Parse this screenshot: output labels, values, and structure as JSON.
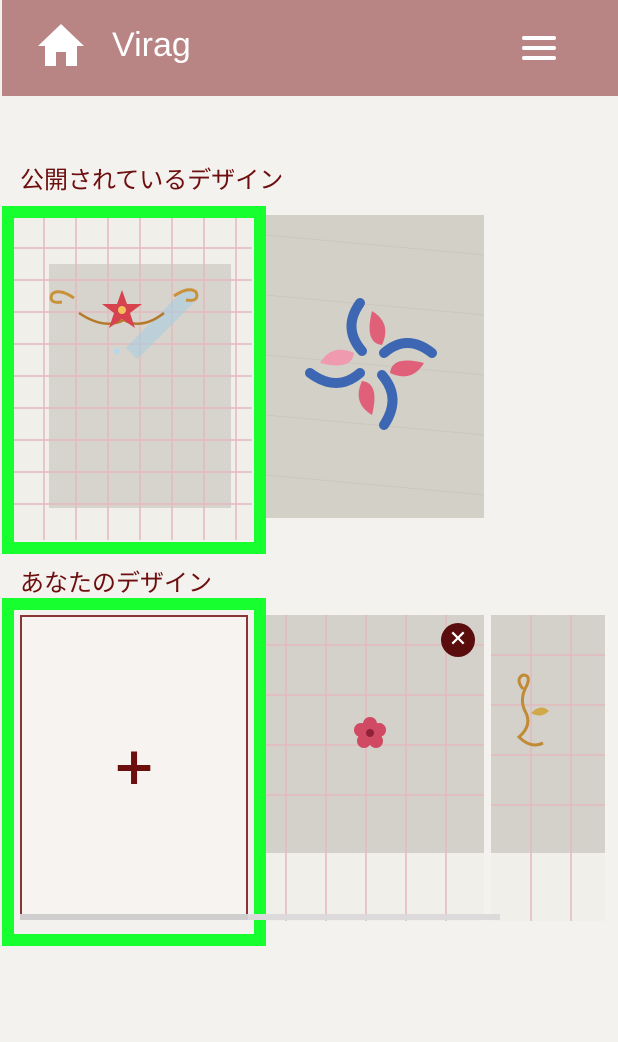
{
  "header": {
    "title": "Virag",
    "home_icon": "home-icon",
    "menu_icon": "hamburger-menu-icon",
    "background": "#b88484"
  },
  "public_designs": {
    "title": "公開されているデザイン",
    "items": [
      {
        "name": "star-flourish-embroidery",
        "selected": true
      },
      {
        "name": "blue-pink-tulip-embroidery",
        "selected": false
      }
    ]
  },
  "your_designs": {
    "title": "あなたのデザイン",
    "add_label": "+",
    "delete_label": "✕",
    "items": [
      {
        "name": "add-new-design",
        "selected": true
      },
      {
        "name": "small-pink-flower-embroidery",
        "selected": false
      },
      {
        "name": "gold-swirl-embroidery",
        "selected": false
      }
    ]
  },
  "colors": {
    "section_title": "#6e0f0f",
    "highlight": "#17ff2e",
    "page_background": "#f3f2ee"
  }
}
